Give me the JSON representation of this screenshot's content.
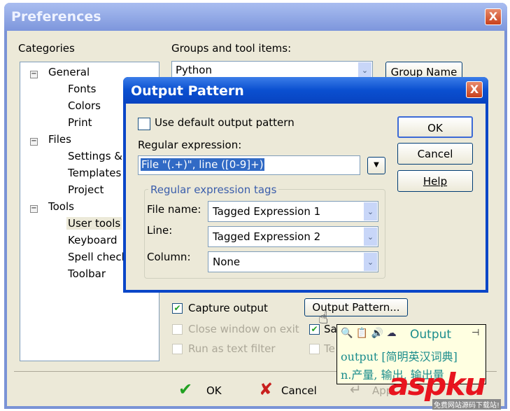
{
  "window": {
    "title": "Preferences",
    "close": "X"
  },
  "categories": {
    "label": "Categories",
    "tree": [
      {
        "label": "General",
        "level": 0
      },
      {
        "label": "Fonts",
        "level": 1
      },
      {
        "label": "Colors",
        "level": 1
      },
      {
        "label": "Print",
        "level": 1
      },
      {
        "label": "Files",
        "level": 0
      },
      {
        "label": "Settings & sy",
        "level": 1
      },
      {
        "label": "Templates",
        "level": 1
      },
      {
        "label": "Project",
        "level": 1
      },
      {
        "label": "Tools",
        "level": 0
      },
      {
        "label": "User tools",
        "level": 1,
        "selected": true
      },
      {
        "label": "Keyboard",
        "level": 1
      },
      {
        "label": "Spell check",
        "level": 1
      },
      {
        "label": "Toolbar",
        "level": 1
      }
    ]
  },
  "groups": {
    "label": "Groups and tool items:",
    "value": "Python",
    "group_name_button": "Group Name"
  },
  "options": {
    "capture_output": {
      "label": "Capture output",
      "checked": true
    },
    "close_window": {
      "label": "Close window on exit",
      "checked": false
    },
    "run_filter": {
      "label": "Run as text filter",
      "checked": false
    },
    "save_partial": "Sa",
    "te_partial": "Te",
    "output_pattern_button": "Output Pattern..."
  },
  "footer": {
    "ok": "OK",
    "cancel": "Cancel",
    "apply": "App"
  },
  "dialog": {
    "title": "Output Pattern",
    "close": "X",
    "use_default": {
      "label": "Use default output pattern",
      "checked": false
    },
    "regex_label": "Regular expression:",
    "regex_value": "File \"(.+)\", line ([0-9]+)",
    "tags_group": "Regular expression tags",
    "file_name_label": "File name:",
    "file_name_value": "Tagged Expression 1",
    "line_label": "Line:",
    "line_value": "Tagged Expression 2",
    "column_label": "Column:",
    "column_value": "None",
    "ok": "OK",
    "cancel": "Cancel",
    "help": "Help"
  },
  "tooltip": {
    "word": "Output",
    "line1": "output [简明英汉词典]",
    "line2": "n.产量, 输出, 输出量"
  },
  "watermark": {
    "brand": "aspku",
    "sub": "免费网站源码下载站!"
  },
  "colors": {
    "dialog_title": "#0a4fd0",
    "selection": "#316ac5",
    "tooltip_text": "#1a8c8c",
    "watermark": "#e8141e"
  }
}
